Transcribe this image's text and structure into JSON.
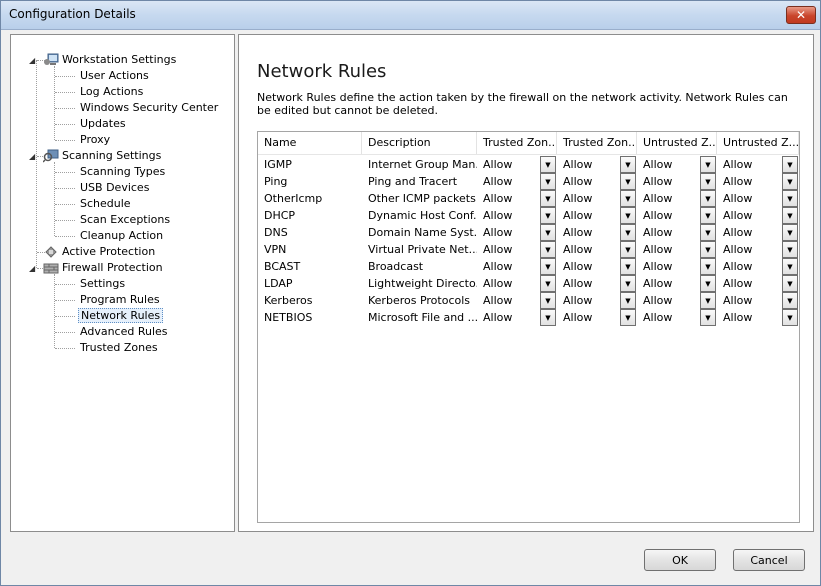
{
  "window": {
    "title": "Configuration Details",
    "close_label": "✕"
  },
  "tree": [
    {
      "label": "Workstation Settings",
      "level": 0,
      "icon": "workstation-icon",
      "expander": "◢"
    },
    {
      "label": "User Actions",
      "level": 1
    },
    {
      "label": "Log Actions",
      "level": 1
    },
    {
      "label": "Windows Security Center",
      "level": 1
    },
    {
      "label": "Updates",
      "level": 1
    },
    {
      "label": "Proxy",
      "level": 1
    },
    {
      "label": "Scanning Settings",
      "level": 0,
      "icon": "scanning-icon",
      "expander": "◢"
    },
    {
      "label": "Scanning Types",
      "level": 1
    },
    {
      "label": "USB Devices",
      "level": 1
    },
    {
      "label": "Schedule",
      "level": 1
    },
    {
      "label": "Scan Exceptions",
      "level": 1
    },
    {
      "label": "Cleanup Action",
      "level": 1
    },
    {
      "label": "Active Protection",
      "level": 0,
      "icon": "shield-icon",
      "expander": ""
    },
    {
      "label": "Firewall Protection",
      "level": 0,
      "icon": "firewall-icon",
      "expander": "◢"
    },
    {
      "label": "Settings",
      "level": 1
    },
    {
      "label": "Program Rules",
      "level": 1
    },
    {
      "label": "Network Rules",
      "level": 1,
      "selected": true
    },
    {
      "label": "Advanced Rules",
      "level": 1
    },
    {
      "label": "Trusted Zones",
      "level": 1
    }
  ],
  "content": {
    "heading": "Network Rules",
    "description": "Network Rules define the action taken by the firewall on the network activity. Network Rules can be edited but cannot be deleted."
  },
  "grid": {
    "columns": [
      "Name",
      "Description",
      "Trusted Zon...",
      "Trusted Zon...",
      "Untrusted Z...",
      "Untrusted Z..."
    ],
    "rows": [
      {
        "name": "IGMP",
        "description": "Internet Group Man...",
        "values": [
          "Allow",
          "Allow",
          "Allow",
          "Allow"
        ]
      },
      {
        "name": "Ping",
        "description": "Ping and Tracert",
        "values": [
          "Allow",
          "Allow",
          "Allow",
          "Allow"
        ]
      },
      {
        "name": "OtherIcmp",
        "description": "Other ICMP packets",
        "values": [
          "Allow",
          "Allow",
          "Allow",
          "Allow"
        ]
      },
      {
        "name": "DHCP",
        "description": "Dynamic Host Conf...",
        "values": [
          "Allow",
          "Allow",
          "Allow",
          "Allow"
        ]
      },
      {
        "name": "DNS",
        "description": "Domain Name Syst...",
        "values": [
          "Allow",
          "Allow",
          "Allow",
          "Allow"
        ]
      },
      {
        "name": "VPN",
        "description": "Virtual Private Net...",
        "values": [
          "Allow",
          "Allow",
          "Allow",
          "Allow"
        ]
      },
      {
        "name": "BCAST",
        "description": "Broadcast",
        "values": [
          "Allow",
          "Allow",
          "Allow",
          "Allow"
        ]
      },
      {
        "name": "LDAP",
        "description": "Lightweight Directo...",
        "values": [
          "Allow",
          "Allow",
          "Allow",
          "Allow"
        ]
      },
      {
        "name": "Kerberos",
        "description": "Kerberos Protocols",
        "values": [
          "Allow",
          "Allow",
          "Allow",
          "Allow"
        ]
      },
      {
        "name": "NETBIOS",
        "description": "Microsoft File and ...",
        "values": [
          "Allow",
          "Allow",
          "Allow",
          "Allow"
        ]
      }
    ],
    "dropdown_arrow": "▼"
  },
  "buttons": {
    "ok": "OK",
    "cancel": "Cancel"
  }
}
